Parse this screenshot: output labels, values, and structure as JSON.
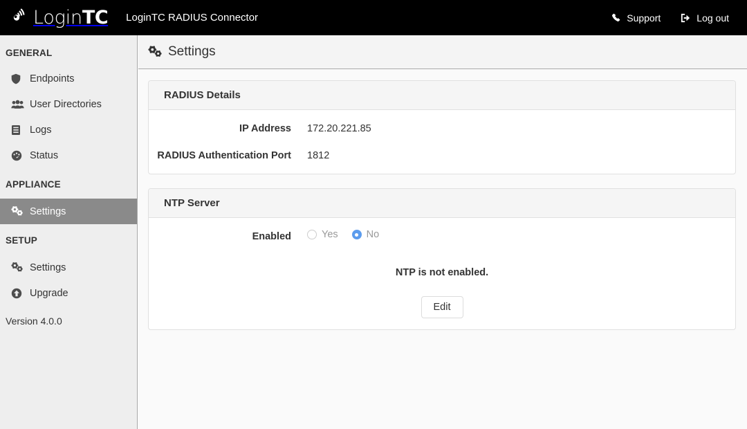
{
  "navbar": {
    "brand_text_light": "Login",
    "brand_text_bold": "TC",
    "app_title": "LoginTC RADIUS Connector",
    "support_label": "Support",
    "logout_label": "Log out",
    "support_icon": "phone-icon",
    "logout_icon": "sign-out-icon",
    "background": "#000000"
  },
  "sidebar": {
    "groups": [
      {
        "heading": "GENERAL",
        "items": [
          {
            "label": "Endpoints",
            "icon": "shield-icon",
            "active": false
          },
          {
            "label": "User Directories",
            "icon": "users-icon",
            "active": false
          },
          {
            "label": "Logs",
            "icon": "book-icon",
            "active": false
          },
          {
            "label": "Status",
            "icon": "tachometer-icon",
            "active": false
          }
        ]
      },
      {
        "heading": "APPLIANCE",
        "items": [
          {
            "label": "Settings",
            "icon": "cogs-icon",
            "active": true
          }
        ]
      },
      {
        "heading": "SETUP",
        "items": [
          {
            "label": "Settings",
            "icon": "cogs-icon",
            "active": false
          },
          {
            "label": "Upgrade",
            "icon": "arrow-circle-up-icon",
            "active": false
          }
        ]
      }
    ],
    "version": "Version 4.0.0",
    "background": "#eeeeee",
    "active_background": "#8a8a8a"
  },
  "page": {
    "title": "Settings",
    "title_icon": "cogs-icon"
  },
  "panels": [
    {
      "title": "RADIUS Details",
      "rows": [
        {
          "label": "IP Address",
          "value": "172.20.221.85"
        },
        {
          "label": "RADIUS Authentication Port",
          "value": "1812"
        }
      ]
    },
    {
      "title": "NTP Server",
      "enabled_label": "Enabled",
      "radios": [
        {
          "label": "Yes",
          "checked": false
        },
        {
          "label": "No",
          "checked": true
        }
      ],
      "notice": "NTP is not enabled.",
      "edit_label": "Edit",
      "radio_accent": "#5c9ced"
    }
  ]
}
